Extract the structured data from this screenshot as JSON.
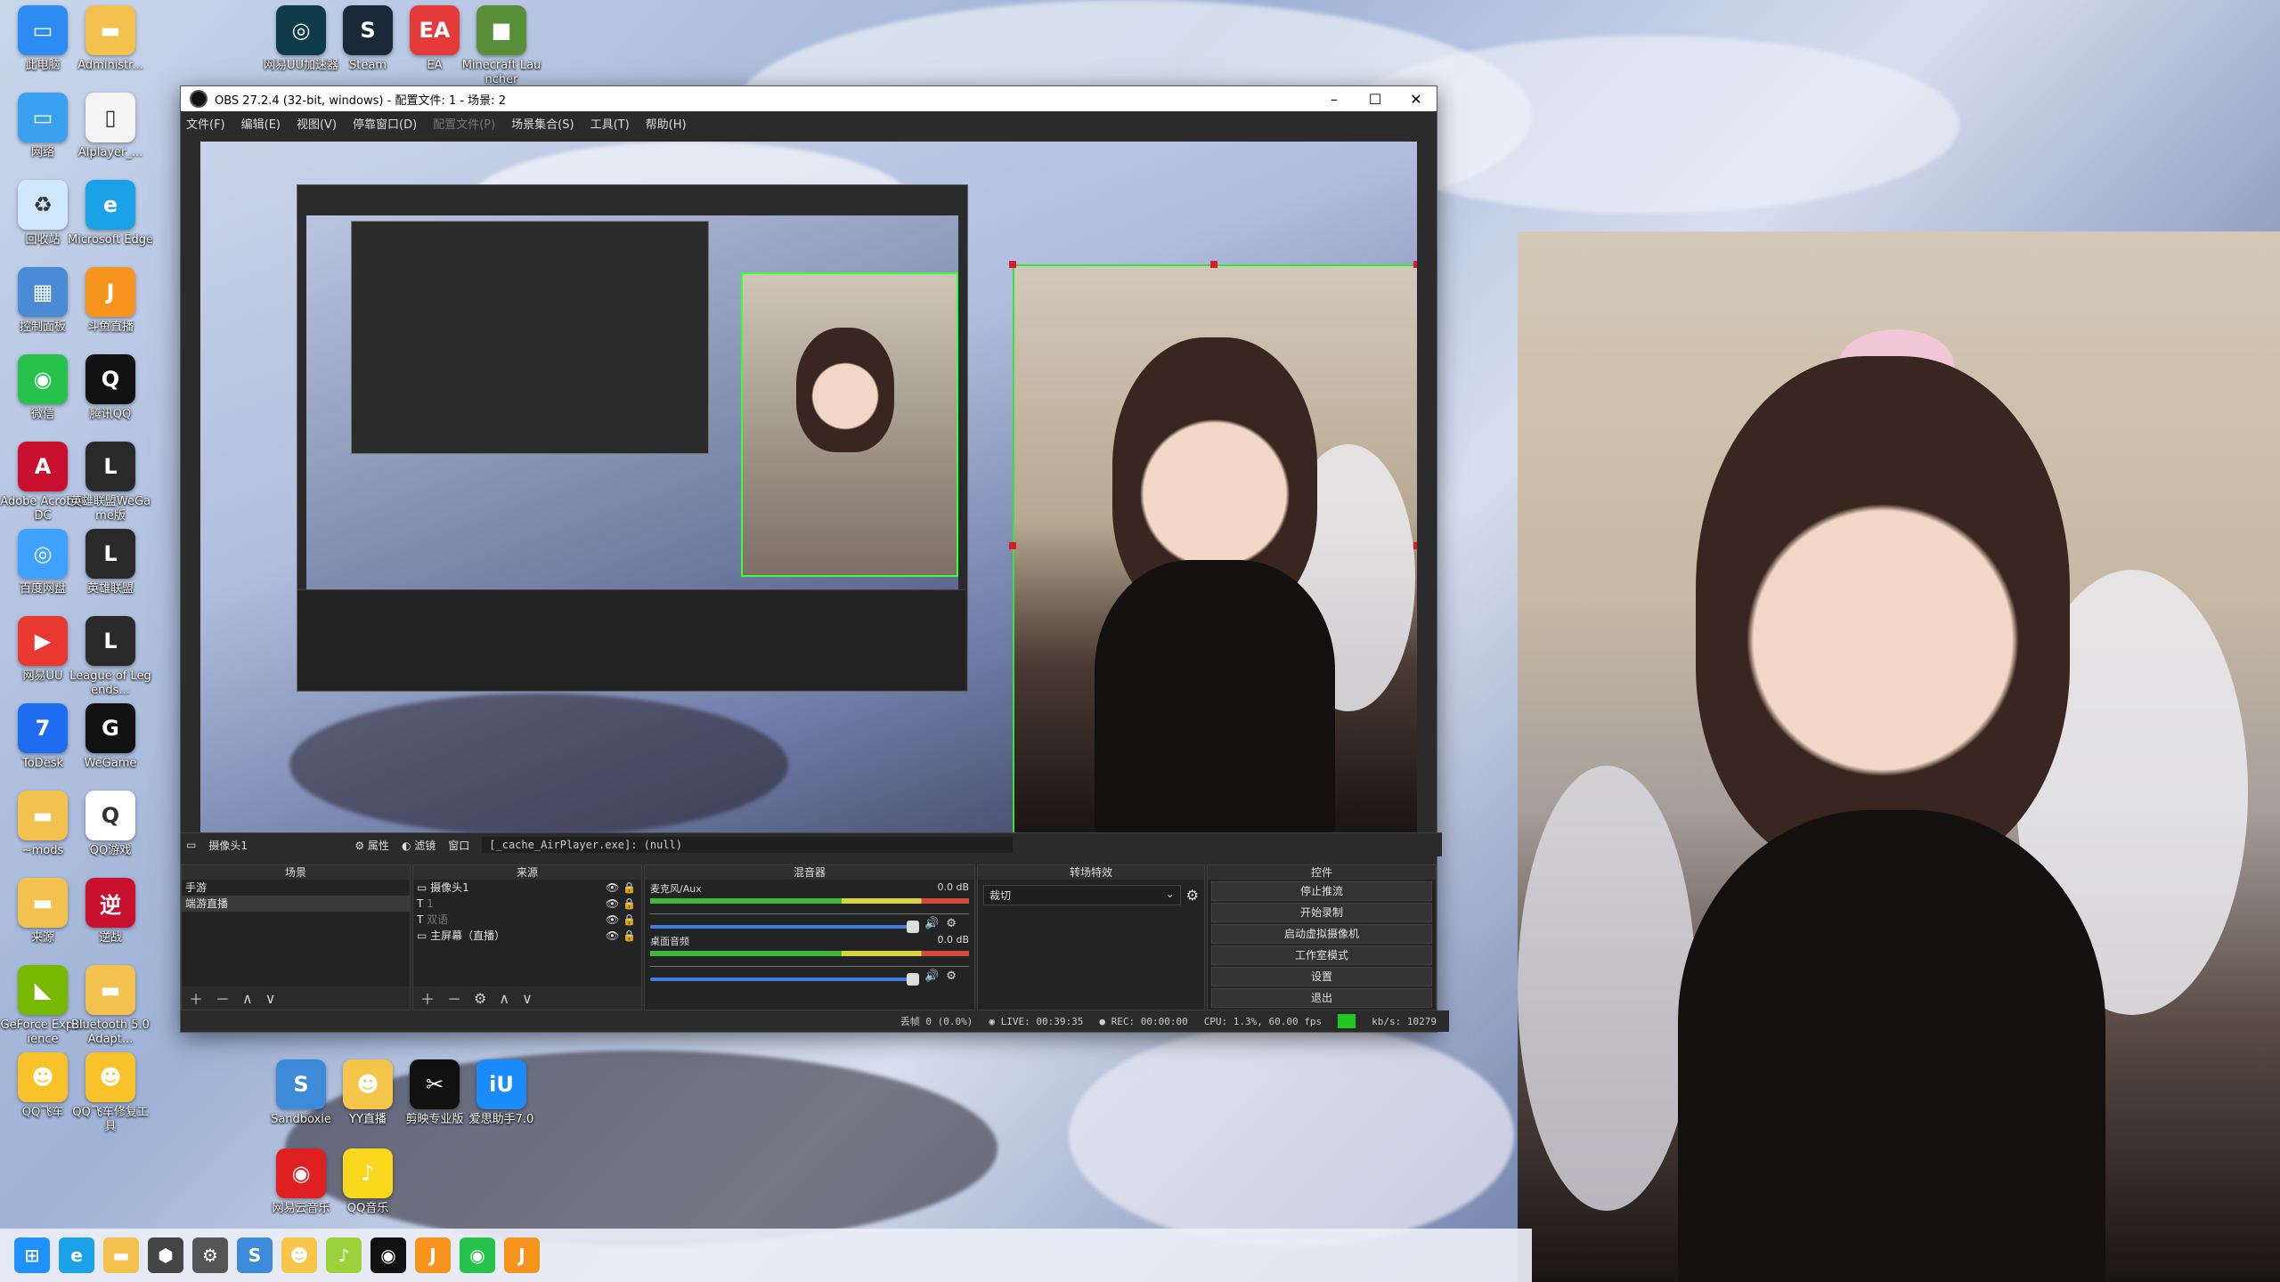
{
  "desktop_icons_left": [
    {
      "label": "此电脑",
      "color": "#2c8cf4",
      "glyph": "▭",
      "icon": "computer-icon"
    },
    {
      "label": "Administr...",
      "color": "#f2c14e",
      "glyph": "▬",
      "icon": "folder-icon"
    },
    {
      "label": "网络",
      "color": "#3aa0f0",
      "glyph": "▭",
      "icon": "network-icon"
    },
    {
      "label": "AIplayer_...",
      "color": "#f5f5f5",
      "glyph": "▯",
      "icon": "file-icon"
    },
    {
      "label": "回收站",
      "color": "#cfe7ff",
      "glyph": "♻",
      "icon": "recycle-bin-icon"
    },
    {
      "label": "Microsoft Edge",
      "color": "#1aa1e6",
      "glyph": "e",
      "icon": "edge-icon"
    },
    {
      "label": "控制面板",
      "color": "#4a8ad6",
      "glyph": "▦",
      "icon": "control-panel-icon"
    },
    {
      "label": "斗鱼直播",
      "color": "#f7941d",
      "glyph": "J",
      "icon": "douyu-icon"
    },
    {
      "label": "微信",
      "color": "#27c24c",
      "glyph": "◉",
      "icon": "wechat-icon"
    },
    {
      "label": "腾讯QQ",
      "color": "#111",
      "glyph": "Q",
      "icon": "qq-icon"
    },
    {
      "label": "Adobe Acrobat DC",
      "color": "#c8102e",
      "glyph": "A",
      "icon": "acrobat-icon"
    },
    {
      "label": "英雄联盟WeGame版",
      "color": "#2a2a2a",
      "glyph": "L",
      "icon": "lol-wegame-icon"
    },
    {
      "label": "百度网盘",
      "color": "#3ea2ff",
      "glyph": "◎",
      "icon": "baidu-netdisk-icon"
    },
    {
      "label": "英雄联盟",
      "color": "#2a2a2a",
      "glyph": "L",
      "icon": "lol-icon"
    },
    {
      "label": "网易UU",
      "color": "#e8382f",
      "glyph": "▶",
      "icon": "uu-icon"
    },
    {
      "label": "League of Legends...",
      "color": "#2a2a2a",
      "glyph": "L",
      "icon": "league-icon"
    },
    {
      "label": "ToDesk",
      "color": "#1e6cf0",
      "glyph": "7",
      "icon": "todesk-icon"
    },
    {
      "label": "WeGame",
      "color": "#111",
      "glyph": "G",
      "icon": "wegame-icon"
    },
    {
      "label": "~mods",
      "color": "#f2c14e",
      "glyph": "▬",
      "icon": "folder-icon"
    },
    {
      "label": "QQ游戏",
      "color": "#fff",
      "glyph": "Q",
      "icon": "qqgame-icon"
    },
    {
      "label": "来源",
      "color": "#f2c14e",
      "glyph": "▬",
      "icon": "folder-icon"
    },
    {
      "label": "逆战",
      "color": "#c8102e",
      "glyph": "逆",
      "icon": "nizhan-icon"
    },
    {
      "label": "GeForce Experience",
      "color": "#76b900",
      "glyph": "◣",
      "icon": "geforce-icon"
    },
    {
      "label": "Bluetooth 5.0 Adapt...",
      "color": "#f2c14e",
      "glyph": "▬",
      "icon": "folder-icon"
    },
    {
      "label": "QQ飞车",
      "color": "#f8c22a",
      "glyph": "☻",
      "icon": "qqspeed-icon"
    },
    {
      "label": "QQ飞车修复工具",
      "color": "#f8c22a",
      "glyph": "☻",
      "icon": "qqspeed-fix-icon"
    }
  ],
  "desktop_icons_top": [
    {
      "label": "网易UU加速器",
      "color": "#0e3b4a",
      "glyph": "◎",
      "icon": "uu-accelerator-icon"
    },
    {
      "label": "Steam",
      "color": "#1b2838",
      "glyph": "S",
      "icon": "steam-icon"
    },
    {
      "label": "EA",
      "color": "#e53a3a",
      "glyph": "EA",
      "icon": "ea-icon"
    },
    {
      "label": "Minecraft Launcher",
      "color": "#5a8f3a",
      "glyph": "■",
      "icon": "minecraft-icon"
    }
  ],
  "desktop_icons_mid": [
    {
      "label": "Sandboxie",
      "color": "#3c8ad8",
      "glyph": "S",
      "icon": "sandbox-icon"
    },
    {
      "label": "YY直播",
      "color": "#f6c64b",
      "glyph": "☻",
      "icon": "yy-icon"
    },
    {
      "label": "剪映专业版",
      "color": "#111",
      "glyph": "✂",
      "icon": "capcut-icon"
    },
    {
      "label": "爱思助手7.0",
      "color": "#1a8cff",
      "glyph": "iU",
      "icon": "i4-icon"
    },
    {
      "label": "网易云音乐",
      "color": "#e02020",
      "glyph": "◉",
      "icon": "netease-music-icon"
    },
    {
      "label": "QQ音乐",
      "color": "#f9d71c",
      "glyph": "♪",
      "icon": "qqmusic-icon"
    }
  ],
  "taskbar": [
    {
      "color": "#1e90ff",
      "glyph": "⊞",
      "icon": "start-icon"
    },
    {
      "color": "#1aa1e6",
      "glyph": "e",
      "icon": "edge-icon"
    },
    {
      "color": "#f2c14e",
      "glyph": "▬",
      "icon": "explorer-icon"
    },
    {
      "color": "#444",
      "glyph": "⬢",
      "icon": "app-icon"
    },
    {
      "color": "#555",
      "glyph": "⚙",
      "icon": "settings-icon"
    },
    {
      "color": "#3c8ad8",
      "glyph": "S",
      "icon": "sandbox-icon"
    },
    {
      "color": "#f6c64b",
      "glyph": "☻",
      "icon": "yy-icon"
    },
    {
      "color": "#9bd13b",
      "glyph": "♪",
      "icon": "music-icon"
    },
    {
      "color": "#111",
      "glyph": "◉",
      "icon": "obs-icon"
    },
    {
      "color": "#f7941d",
      "glyph": "J",
      "icon": "douyu-icon"
    },
    {
      "color": "#27c24c",
      "glyph": "◉",
      "icon": "wechat-icon"
    },
    {
      "color": "#f7941d",
      "glyph": "J",
      "icon": "douyu2-icon"
    }
  ],
  "obs": {
    "title": "OBS 27.2.4 (32-bit, windows) - 配置文件: 1 - 场景: 2",
    "menu": [
      "文件(F)",
      "编辑(E)",
      "视图(V)",
      "停靠窗口(D)",
      "配置文件(P)",
      "场景集合(S)",
      "工具(T)",
      "帮助(H)"
    ],
    "menu_disabled_index": 4,
    "source_bar": {
      "source_name": "摄像头1",
      "properties": "属性",
      "filters": "滤镜",
      "window_label": "窗口",
      "window_value": "[_cache_AirPlayer.exe]: (null)"
    },
    "docks": {
      "scenes": {
        "title": "场景",
        "items": [
          "手游",
          "端游直播"
        ],
        "selected": 1
      },
      "sources": {
        "title": "来源",
        "items": [
          "摄像头1",
          "1",
          "双语",
          "主屏幕（直播）"
        ]
      },
      "mixer": {
        "title": "混音器",
        "channels": [
          {
            "name": "麦克风/Aux",
            "db": "0.0 dB"
          },
          {
            "name": "桌面音频",
            "db": "0.0 dB"
          }
        ],
        "scale": [
          "-60",
          "-55",
          "-50",
          "-45",
          "-40",
          "-35",
          "-30",
          "-25",
          "-20",
          "-15",
          "-10",
          "-5",
          "0"
        ]
      },
      "transitions": {
        "title": "转场特效",
        "value": "裁切"
      },
      "controls": {
        "title": "控件",
        "buttons": [
          "停止推流",
          "开始录制",
          "启动虚拟摄像机",
          "工作室模式",
          "设置",
          "退出"
        ]
      }
    },
    "status": {
      "dropped": "丢帧 0 (0.0%)",
      "live": "LIVE: 00:39:35",
      "rec": "REC: 00:00:00",
      "cpu": "CPU: 1.3%, 60.00 fps",
      "bitrate": "kb/s: 10279"
    }
  }
}
